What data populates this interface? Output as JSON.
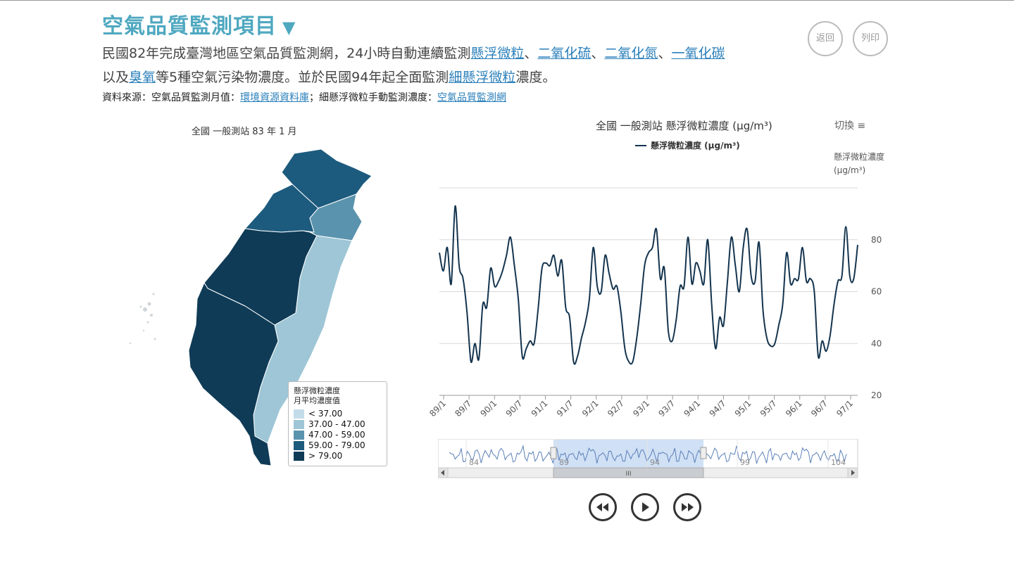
{
  "page": {
    "title": "空氣品質監測項目",
    "title_arrow": "▼",
    "back_label": "返回",
    "print_label": "列印"
  },
  "description": {
    "line1_prefix": "民國82年完成臺灣地區空氣品質監測網，24小時自動連續監測",
    "link_pm10": "懸浮微粒",
    "sep1": "、",
    "link_so2": "二氧化硫",
    "sep2": "、",
    "link_no2": "二氧化氮",
    "sep3": "、",
    "link_co": "一氧化碳",
    "line2_prefix": "以及",
    "link_o3": "臭氧",
    "line2_mid": "等5種空氣污染物濃度。並於民國94年起全面監測",
    "link_pm25": "細懸浮微粒",
    "line2_suffix": "濃度。"
  },
  "source": {
    "prefix": "資料來源：空氣品質監測月值：",
    "link1": "環境資源資料庫",
    "mid": "；細懸浮微粒手動監測濃度：",
    "link2": "空氣品質監測網"
  },
  "map": {
    "title": "全國 一般測站 83 年 1 月",
    "legend_title_1": "懸浮微粒濃度",
    "legend_title_2": "月平均濃度值",
    "legend_items": [
      {
        "label": "< 37.00",
        "color": "#c3dcea"
      },
      {
        "label": "37.00 - 47.00",
        "color": "#9ec6d6"
      },
      {
        "label": "47.00 - 59.00",
        "color": "#5a93ad"
      },
      {
        "label": "59.00 - 79.00",
        "color": "#1d5b7e"
      },
      {
        "label": "> 79.00",
        "color": "#0f3b56"
      }
    ]
  },
  "chart_controls": {
    "switch_label": "切換 ≡",
    "y_title_1": "懸浮微粒濃度",
    "y_title_2": "(µg/m³)"
  },
  "chart_data": {
    "type": "line",
    "title": "全國 一般測站 懸浮微粒濃度 (µg/m³)",
    "ylabel": "懸浮微粒濃度 (µg/m³)",
    "ylim": [
      20,
      100
    ],
    "yticks": [
      20,
      40,
      60,
      80
    ],
    "x_tick_labels": [
      "89/1",
      "89/7",
      "90/1",
      "90/7",
      "91/1",
      "91/7",
      "92/1",
      "92/7",
      "93/1",
      "93/7",
      "94/1",
      "94/7",
      "95/1",
      "95/7",
      "96/1",
      "96/7",
      "97/1"
    ],
    "series": [
      {
        "name": "懸浮微粒濃度 (µg/m³)",
        "color": "#14344e",
        "values": [
          75,
          68,
          77,
          63,
          93,
          70,
          65,
          52,
          33,
          40,
          34,
          55,
          54,
          69,
          62,
          64,
          68,
          74,
          81,
          70,
          57,
          35,
          38,
          41,
          40,
          53,
          69,
          71,
          70,
          74,
          66,
          72,
          54,
          50,
          33,
          35,
          42,
          48,
          57,
          77,
          62,
          60,
          74,
          67,
          61,
          62,
          52,
          38,
          33,
          33,
          42,
          55,
          70,
          75,
          77,
          84,
          65,
          69,
          45,
          41,
          49,
          62,
          62,
          81,
          63,
          71,
          68,
          63,
          80,
          55,
          38,
          50,
          47,
          64,
          81,
          70,
          60,
          77,
          84,
          66,
          64,
          79,
          53,
          42,
          39,
          40,
          47,
          55,
          75,
          63,
          65,
          65,
          77,
          64,
          65,
          60,
          35,
          41,
          37,
          43,
          55,
          64,
          66,
          85,
          66,
          65,
          78
        ]
      }
    ],
    "navigator": {
      "tick_labels": [
        "84",
        "89",
        "94",
        "99",
        "104"
      ],
      "selected_range": [
        "89/1",
        "97/1"
      ]
    }
  },
  "playback": {
    "rewind": "rewind-icon",
    "play": "play-icon",
    "forward": "fast-forward-icon"
  }
}
